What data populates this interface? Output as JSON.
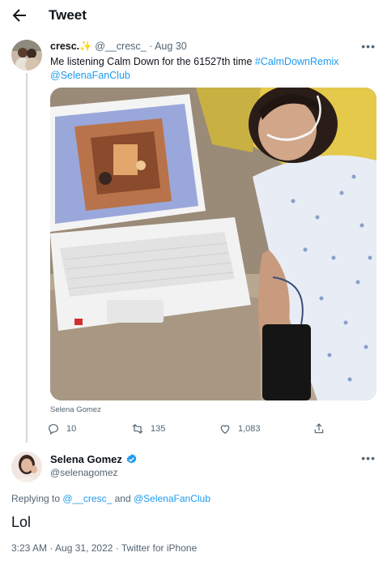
{
  "header": {
    "title": "Tweet"
  },
  "tweet1": {
    "display_name": "cresc.",
    "sparkle": "✨",
    "handle": "@__cresc_",
    "separator": "·",
    "date": "Aug 30",
    "text": "Me listening Calm Down for the 61527th time",
    "hashtag": "#CalmDownRemix",
    "mention": "@SelenaFanClub",
    "media_caption": "Selena Gomez",
    "stats": {
      "replies": "10",
      "retweets": "135",
      "likes": "1,083"
    }
  },
  "tweet2": {
    "display_name": "Selena Gomez",
    "handle": "@selenagomez",
    "replying_prefix": "Replying to",
    "replying_user1": "@__cresc_",
    "replying_and": "and",
    "replying_user2": "@SelenaFanClub",
    "text": "Lol",
    "meta": "3:23 AM · Aug 31, 2022 · Twitter for iPhone"
  },
  "colors": {
    "accent": "#1d9bf0",
    "muted": "#536471",
    "text": "#0f1419",
    "divider": "#cfd9de"
  }
}
